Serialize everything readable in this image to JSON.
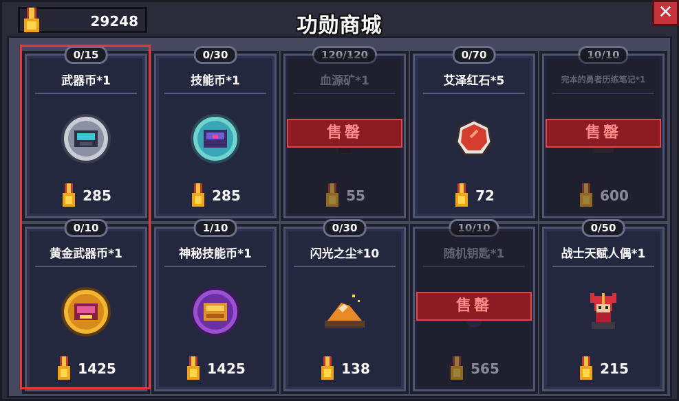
{
  "header": {
    "currency_value": "29248",
    "title": "功勋商城",
    "close_label": "✕"
  },
  "items": [
    {
      "stock": "0/15",
      "name": "武器币*1",
      "price": "285",
      "sold_out": false,
      "icon": "weapon-coin-icon"
    },
    {
      "stock": "0/30",
      "name": "技能币*1",
      "price": "285",
      "sold_out": false,
      "icon": "skill-coin-icon"
    },
    {
      "stock": "120/120",
      "name": "血源矿*1",
      "price": "55",
      "sold_out": true,
      "sold_out_label": "售罄",
      "icon": "blood-ore-icon"
    },
    {
      "stock": "0/70",
      "name": "艾泽红石*5",
      "price": "72",
      "sold_out": false,
      "icon": "red-stone-icon"
    },
    {
      "stock": "10/10",
      "name": "完本的勇者历练笔记*1",
      "price": "600",
      "sold_out": true,
      "sold_out_label": "售罄",
      "icon": "notebook-icon"
    },
    {
      "stock": "0/10",
      "name": "黄金武器币*1",
      "price": "1425",
      "sold_out": false,
      "icon": "gold-weapon-coin-icon"
    },
    {
      "stock": "1/10",
      "name": "神秘技能币*1",
      "price": "1425",
      "sold_out": false,
      "icon": "mystery-skill-coin-icon"
    },
    {
      "stock": "0/30",
      "name": "闪光之尘*10",
      "price": "138",
      "sold_out": false,
      "icon": "glitter-dust-icon"
    },
    {
      "stock": "10/10",
      "name": "随机钥匙*1",
      "price": "565",
      "sold_out": true,
      "sold_out_label": "售罄",
      "icon": "random-key-icon"
    },
    {
      "stock": "0/50",
      "name": "战士天赋人偶*1",
      "price": "215",
      "sold_out": false,
      "icon": "warrior-doll-icon"
    }
  ],
  "colors": {
    "accent_red": "#e83838",
    "sold_out_bg": "#8c1c22",
    "medal_gold": "#f2a31b"
  }
}
